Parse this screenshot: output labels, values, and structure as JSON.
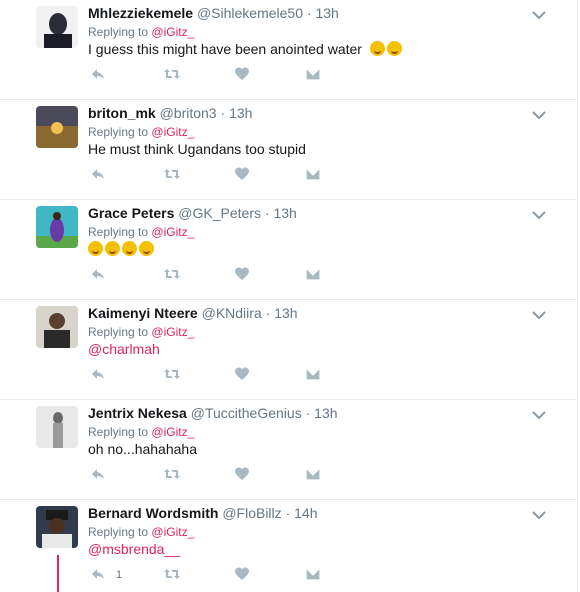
{
  "tweets": [
    {
      "name": "Mhlezziekemele",
      "handle": "@Sihlekemele50",
      "time": "13h",
      "replying_prefix": "Replying to",
      "replying_to": "@iGitz_",
      "text": "I guess this might have been anointed water",
      "emojis": [
        "tears-of-joy-emoji",
        "tears-of-joy-emoji"
      ],
      "avatar_color": "#2b2b3a"
    },
    {
      "name": "briton_mk",
      "handle": "@briton3",
      "time": "13h",
      "replying_prefix": "Replying to",
      "replying_to": "@iGitz_",
      "text": "He must think Ugandans too stupid",
      "avatar_color": "#6a5a3a"
    },
    {
      "name": "Grace Peters",
      "handle": "@GK_Peters",
      "time": "13h",
      "replying_prefix": "Replying to",
      "replying_to": "@iGitz_",
      "text": "",
      "emojis": [
        "tears-of-joy-emoji",
        "tears-of-joy-emoji",
        "confused-face-emoji",
        "tears-of-joy-emoji"
      ],
      "avatar_color": "#3fb7c4"
    },
    {
      "name": "Kaimenyi Nteere",
      "handle": "@KNdiira",
      "time": "13h",
      "replying_prefix": "Replying to",
      "replying_to": "@iGitz_",
      "text": "@charlmah",
      "text_is_mention": true,
      "avatar_color": "#7a6a5a"
    },
    {
      "name": "Jentrix Nekesa",
      "handle": "@TuccitheGenius",
      "time": "13h",
      "replying_prefix": "Replying to",
      "replying_to": "@iGitz_",
      "text": "oh no...hahahaha",
      "avatar_color": "#b5b5b5"
    },
    {
      "name": "Bernard Wordsmith",
      "handle": "@FloBillz",
      "time": "14h",
      "replying_prefix": "Replying to",
      "replying_to": "@iGitz_",
      "text": "@msbrenda__",
      "text_is_mention": true,
      "reply_count": "1",
      "avatar_color": "#3a3a3a"
    }
  ],
  "colors": {
    "icon_gray": "#aab8c2",
    "mention": "#e0245e",
    "meta": "#657786",
    "divider": "#e6ecf0"
  },
  "icons": [
    "reply-icon",
    "retweet-icon",
    "like-icon",
    "direct-message-icon",
    "chevron-down-icon"
  ]
}
